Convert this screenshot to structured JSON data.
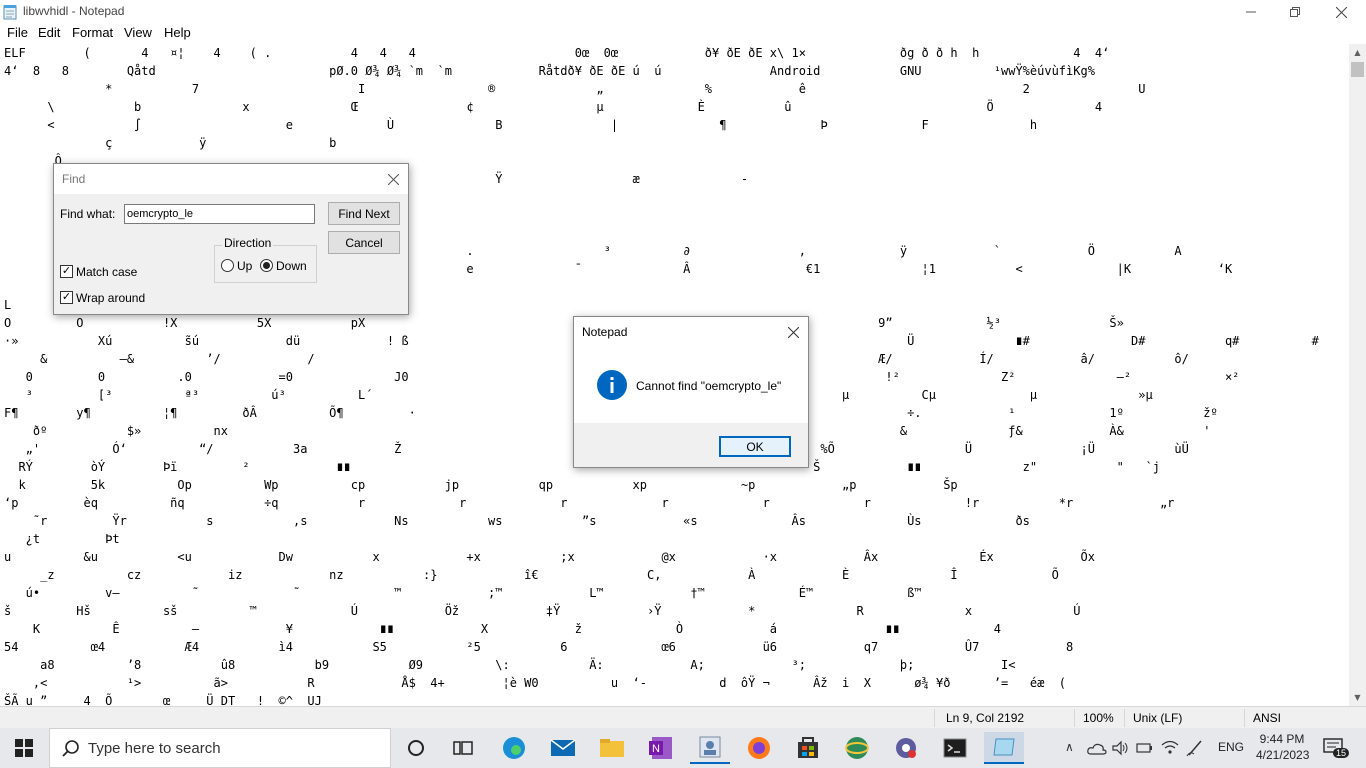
{
  "window": {
    "title": "libwvhidl - Notepad",
    "minimize_icon": "minimize-icon",
    "restore_icon": "restore-icon",
    "close_icon": "close-icon"
  },
  "menu": [
    "File",
    "Edit",
    "Format",
    "View",
    "Help"
  ],
  "editor": {
    "lines": [
      "ELF        (       4   ¤¦    4    ( .           4   4   4                      0œ  0œ            ð¥ ðE ðE x\\ 1×             ðg ð ð h  h             4  4‘",
      "4‘  8   8        Qåtd                        pØ.0 Ø¾ Ø¾ `m  `m            Råtdð¥ ðE ðE ú  ú               Android           GNU          ¹wwŸ%èúvùfìKg%",
      "              *           7                      I                 ®              „              %            ê                              2               U",
      "      \\           b              x              Œ               ¢                 µ             È           û                           Ö              4",
      "      <           ∫                    e             Ù              B               |              ¶             Þ             F              h",
      "              ç            ÿ                 b",
      "       Ô",
      "                                                                    Ÿ                  æ              -",
      "",
      "",
      "",
      "                                                                .                  ³          ∂               ,             ÿ            `            Ö           A",
      "                                                                e              ¯              Â                €1              ¦1           <             |K            ‘K",
      "",
      "L",
      "O         O           !X           5X           pX                                                                       9”             ½³               Š»",
      "·»           Xú          s̃ú            dü            ! ß                                                                     Ü              ∎#              D#           q#          #",
      "     &          –&          ’/            /                                                                  À/          Æ/            Í/            â/           ô/",
      "   0         0          .0            =0              J0                                                                  !²              Z²              –²             ×²",
      "   ³         [³          ª³          ú³          L´                                                                 µ          Cµ             µ              »µ",
      "F¶        y¶          ¦¶         ðÂ          Õ¶         ·                                                    R.              ÷.            ¹             1º           žº",
      "    ðº           $»          nx                                                                             %               &              ƒ&            À&           '",
      "   „'          Ó‘          “/           3a            Ž                                                          %Õ                  Ü               ¡Ü           ùÜ",
      "  RÝ        òÝ        Þï         ²            ∎∎                                                                Š            ∎∎              z\"           \"   `j",
      "  k         5k          Op          Wp          cp           jp           qp           xp             ~p            „p            Šp",
      "‘p         èq          ñq           ÷q           r             r             r             r             r             r             !r           *r            „r",
      "    ˜r         Ÿr           s           ,s            Ns           ws           ”s            «s             Âs              Ùs             ðs",
      "   ¿t         Þt",
      "u          &u           <u            Dw           x            +x           ;x            @x            ·x            Âx              Éx            Õx",
      "     _z          cz            iz            nz           :}            î€               C,            À            È              Î             Õ",
      "   ú•         v–          ˜             ˜             ™            ;™            L™            †™             É™             ß™",
      "š         Hš          sš          ™             Ú            Öž            ‡Ÿ            ›Ÿ            *              R              x              Ú",
      "    K          Ê          –            ¥            ∎∎            X            ž             Ò            á               ∎∎             4",
      "54          œ4           Æ4           ì4           S5           ²5           6             œ6            ü6            q7            Û7            8",
      "     a8          ’8           û8           b9           Ø9          \\:           Ä:            A;            ³;             þ;            I<",
      "    ,<           ¹>          ã>           R            Å$  4+        ¦è W0          u  ‘-          d  ôŸ ¬      Âž  i  X      ø¾ ¥ð      ’=   éæ  (",
      "ŠÃ u ”     4  Õ       œ     Ü DT   !  ©^  UJ"
    ]
  },
  "find_dialog": {
    "title": "Find",
    "find_what_label": "Find what:",
    "find_what_value": "oemcrypto_le",
    "find_next_label": "Find Next",
    "cancel_label": "Cancel",
    "direction_label": "Direction",
    "up_label": "Up",
    "down_label": "Down",
    "direction_selected": "Down",
    "match_case_label": "Match case",
    "match_case_checked": true,
    "wrap_around_label": "Wrap around",
    "wrap_around_checked": true
  },
  "alert_dialog": {
    "title": "Notepad",
    "message": "Cannot find \"oemcrypto_le\"",
    "ok_label": "OK",
    "icon": "info-icon"
  },
  "statusbar": {
    "position": "Ln 9, Col 2192",
    "zoom": "100%",
    "line_ending": "Unix (LF)",
    "encoding": "ANSI"
  },
  "taskbar": {
    "search_placeholder": "Type here to search",
    "time": "9:44 PM",
    "date": "4/21/2023",
    "language": "ENG",
    "notification_count": "15",
    "apps": [
      "task-view-icon",
      "widgets-icon",
      "edge-icon",
      "mail-icon",
      "file-explorer-icon",
      "onenote-icon",
      "contacts-icon",
      "firefox-icon",
      "store-icon",
      "globe-app-icon",
      "settings-app-icon",
      "terminal-icon",
      "notepad-icon"
    ]
  },
  "colors": {
    "accent": "#0067c0",
    "taskbar_bg": "#e6e8ec",
    "dialog_bg": "#f0f0f0"
  }
}
